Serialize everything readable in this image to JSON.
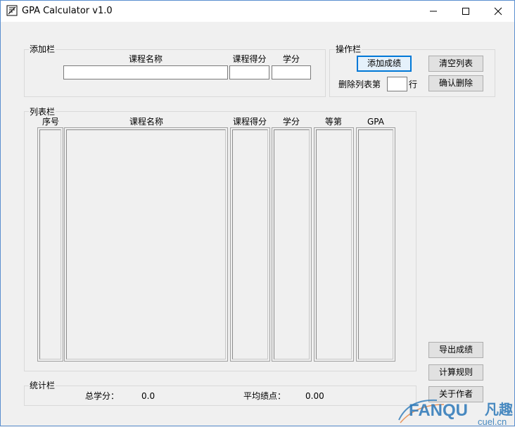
{
  "window": {
    "title": "GPA Calculator v1.0"
  },
  "add_group": {
    "legend": "添加栏",
    "course_name_label": "课程名称",
    "score_label": "课程得分",
    "credit_label": "学分",
    "course_name_value": "",
    "score_value": "",
    "credit_value": ""
  },
  "ops_group": {
    "legend": "操作栏",
    "add_button": "添加成绩",
    "clear_button": "清空列表",
    "delete_prefix": "删除列表第",
    "delete_suffix": "行",
    "delete_row_value": "",
    "confirm_delete_button": "确认删除"
  },
  "list_group": {
    "legend": "列表栏",
    "columns": [
      "序号",
      "课程名称",
      "课程得分",
      "学分",
      "等第",
      "GPA"
    ]
  },
  "side_buttons": {
    "export": "导出成绩",
    "rules": "计算规则",
    "about": "关于作者"
  },
  "stats_group": {
    "legend": "统计栏",
    "total_credits_label": "总学分：",
    "total_credits_value": "0.0",
    "avg_gpa_label": "平均绩点：",
    "avg_gpa_value": "0.00"
  },
  "watermark": {
    "brand": "FANQU",
    "cn": "凡趣",
    "domain": "cuel.cn"
  },
  "colors": {
    "accent": "#0078d7",
    "watermark_blue": "#2b78b8",
    "watermark_orange": "#e8803a"
  }
}
